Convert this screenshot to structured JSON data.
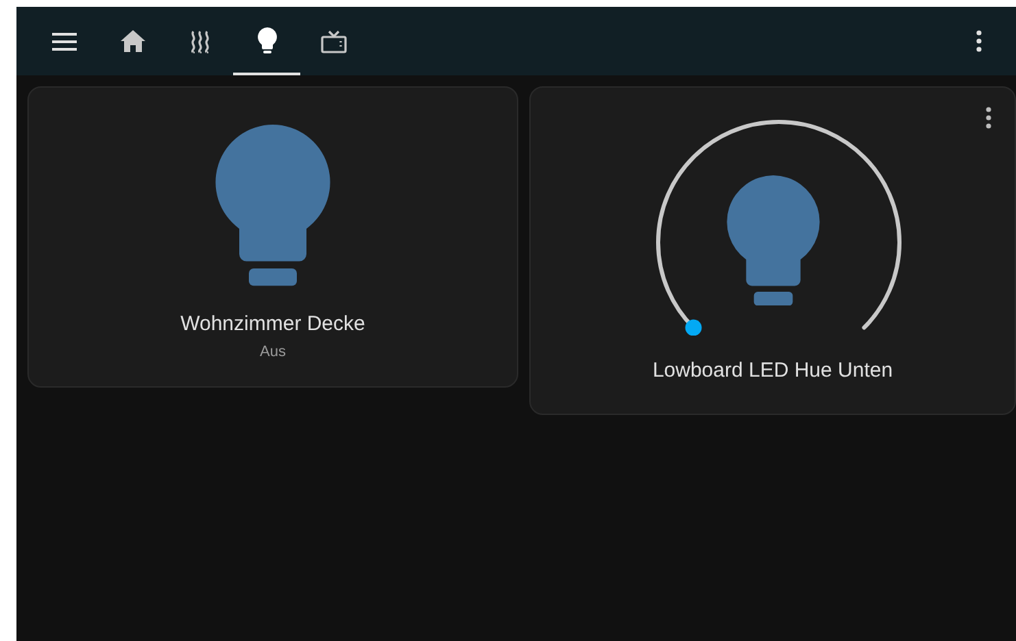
{
  "header": {
    "tabs": [
      {
        "kind": "home",
        "selected": false
      },
      {
        "kind": "heat",
        "selected": false
      },
      {
        "kind": "bulb",
        "selected": true
      },
      {
        "kind": "tv",
        "selected": false
      }
    ]
  },
  "cards": [
    {
      "kind": "button",
      "name": "Wohnzimmer Decke",
      "state": "Aus"
    },
    {
      "kind": "light",
      "name": "Lowboard LED Hue Unten"
    }
  ]
}
